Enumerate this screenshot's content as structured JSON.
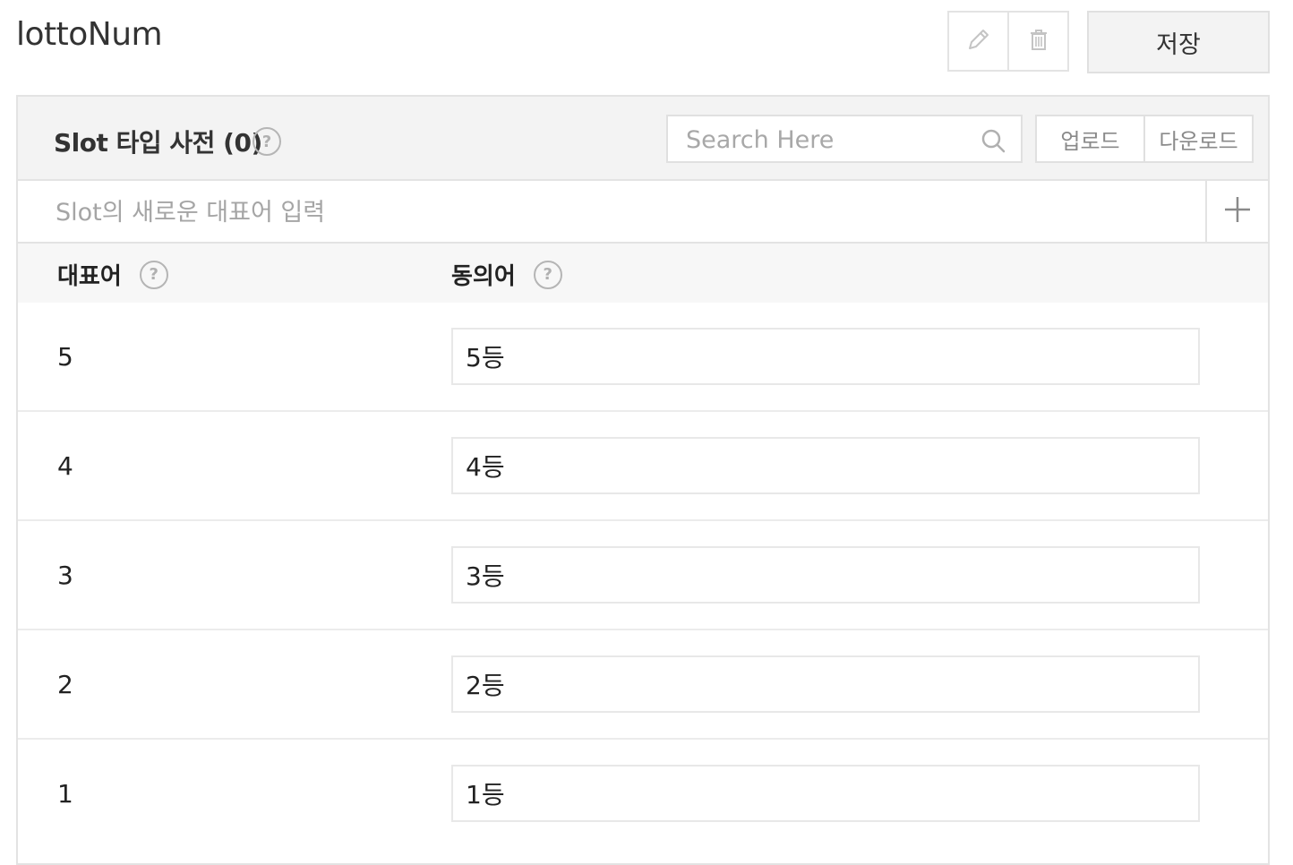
{
  "header": {
    "title": "lottoNum",
    "save_label": "저장",
    "icons": [
      "pencil-icon",
      "trash-icon"
    ]
  },
  "panel": {
    "title": "Slot 타입 사전 (0)",
    "help_glyph": "?",
    "search": {
      "placeholder": "Search Here",
      "value": ""
    },
    "upload_label": "업로드",
    "download_label": "다운로드",
    "new_entry": {
      "placeholder": "Slot의 새로운 대표어 입력",
      "value": ""
    },
    "columns": {
      "representative": "대표어",
      "synonym": "동의어"
    },
    "rows": [
      {
        "rep": "5",
        "synonym": "5등"
      },
      {
        "rep": "4",
        "synonym": "4등"
      },
      {
        "rep": "3",
        "synonym": "3등"
      },
      {
        "rep": "2",
        "synonym": "2등"
      },
      {
        "rep": "1",
        "synonym": "1등"
      }
    ]
  },
  "colors": {
    "border": "#e3e3e3",
    "header_bg": "#f3f3f3",
    "muted_text": "#a8a8a8"
  }
}
